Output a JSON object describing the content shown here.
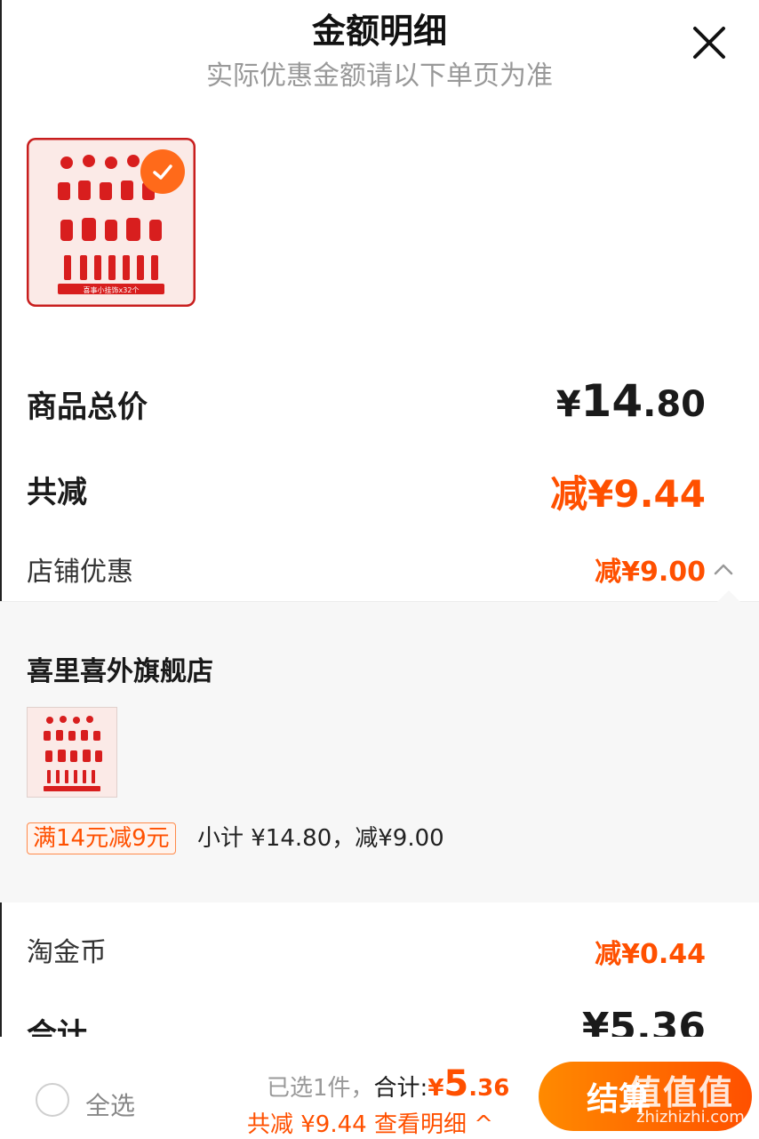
{
  "header": {
    "title": "金额明细",
    "subtitle": "实际优惠金额请以下单页为准"
  },
  "summary": {
    "total_label": "商品总价",
    "total_currency": "¥",
    "total_int": "14",
    "total_dec": ".80",
    "reduce_label": "共减",
    "reduce_value": "减¥9.44",
    "store_discount_label": "店铺优惠",
    "store_discount_value": "减¥9.00"
  },
  "store_panel": {
    "store_name": "喜里喜外旗舰店",
    "promo_tag": "满14元减9元",
    "subtotal_text": "小计 ¥14.80，减¥9.00"
  },
  "coins": {
    "label": "淘金币",
    "value": "减¥0.44"
  },
  "grand_total": {
    "label": "合计",
    "value": "¥5.36"
  },
  "footer": {
    "select_all": "全选",
    "selected_text": "已选1件，",
    "sum_label": "合计:",
    "sum_currency": "¥",
    "sum_int": "5",
    "sum_dec": ".36",
    "reduce_detail": "共减 ¥9.44 查看明细 ^",
    "checkout_label": "结算"
  },
  "product_image_caption": "喜事小挂饰x32个",
  "watermark": {
    "text": "值值值",
    "url": "zhizhizhi.com"
  },
  "colors": {
    "accent": "#ff5000",
    "checkout_start": "#ff8a00",
    "checkout_end": "#ff5000"
  }
}
